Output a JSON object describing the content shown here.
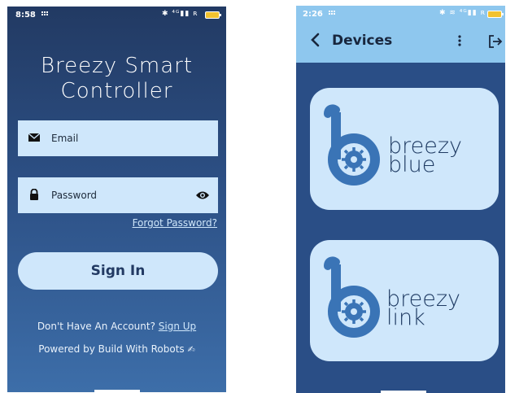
{
  "login": {
    "status": {
      "time": "8:58"
    },
    "title_line1": "Breezy Smart",
    "title_line2": "Controller",
    "email_label": "Email",
    "password_label": "Password",
    "forgot": "Forgot Password?",
    "signin": "Sign In",
    "no_account": "Don't Have An Account?",
    "signup": "Sign Up",
    "powered": "Powered by Build With Robots"
  },
  "devices": {
    "status": {
      "time": "2:26"
    },
    "title": "Devices",
    "cards": [
      {
        "line1": "breezy",
        "line2": "blue"
      },
      {
        "line1": "breezy",
        "line2": "link"
      }
    ]
  },
  "colors": {
    "login_bg_top": "#223a63",
    "login_bg_bottom": "#3d6ea9",
    "field": "#cfe7fb",
    "devices_bg": "#2a4e86",
    "devices_bar": "#8ec7ee",
    "logo_blue": "#3a74b6"
  }
}
